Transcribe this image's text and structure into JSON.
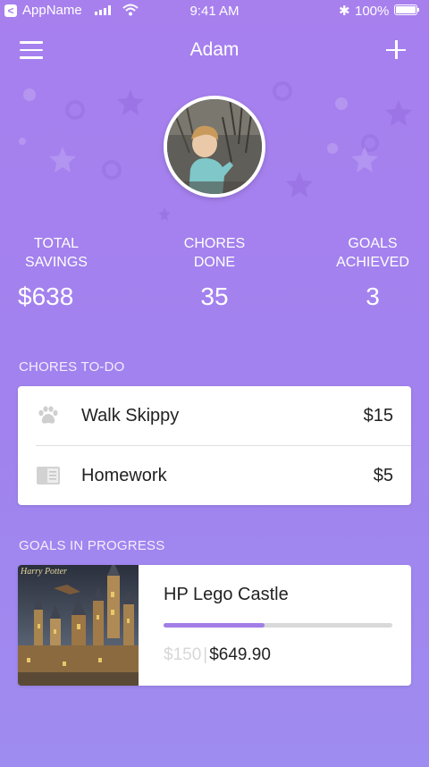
{
  "status_bar": {
    "back_glyph": "<",
    "app_name": "AppName",
    "time": "9:41 AM",
    "bluetooth_glyph": "✱",
    "battery": "100%",
    "icons": [
      "back-chevron-icon",
      "signal-icon",
      "wifi-icon",
      "bluetooth-icon",
      "battery-icon"
    ]
  },
  "header": {
    "title": "Adam",
    "menu_icon": "hamburger-menu-icon",
    "add_icon": "plus-icon"
  },
  "profile": {
    "avatar": "child-photo-avatar"
  },
  "stats": [
    {
      "label_line1": "TOTAL",
      "label_line2": "SAVINGS",
      "value": "$638"
    },
    {
      "label_line1": "CHORES",
      "label_line2": "DONE",
      "value": "35"
    },
    {
      "label_line1": "GOALS",
      "label_line2": "ACHIEVED",
      "value": "3"
    }
  ],
  "chores": {
    "section_label": "CHORES TO-DO",
    "items": [
      {
        "name": "Walk Skippy",
        "amount": "$15",
        "icon": "paw-icon"
      },
      {
        "name": "Homework",
        "amount": "$5",
        "icon": "book-icon"
      }
    ]
  },
  "goals": {
    "section_label": "GOALS IN PROGRESS",
    "items": [
      {
        "name": "HP Lego Castle",
        "saved": "$150",
        "separator": "|",
        "target": "$649.90",
        "progress": 0.44,
        "image": "lego-castle-box-image",
        "box_text": "Harry Potter"
      }
    ]
  },
  "colors": {
    "background_top": "#a780ee",
    "background_bottom": "#9f8cf0",
    "accent": "#a27ee6",
    "card": "#ffffff"
  }
}
